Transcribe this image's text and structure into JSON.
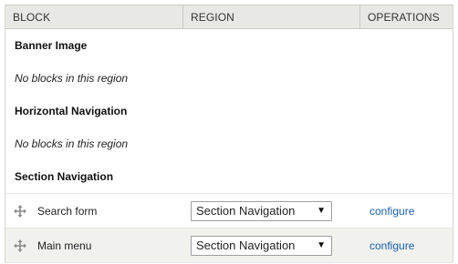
{
  "table": {
    "headers": {
      "block": "Block",
      "region": "Region",
      "operations": "Operations"
    },
    "regions": [
      {
        "title": "Banner Image",
        "empty_message": "No blocks in this region"
      },
      {
        "title": "Horizontal Navigation",
        "empty_message": "No blocks in this region"
      },
      {
        "title": "Section Navigation"
      }
    ],
    "rows": [
      {
        "name": "Search form",
        "region_value": "Section Navigation",
        "operation": "configure"
      },
      {
        "name": "Main menu",
        "region_value": "Section Navigation",
        "operation": "configure"
      }
    ]
  },
  "icons": {
    "drag": "drag-handle-icon",
    "select_arrow": "caret-down-icon"
  },
  "colors": {
    "link": "#1a5fa8",
    "header_bg": "#e8e8e5",
    "alt_row_bg": "#f1f1ee"
  }
}
